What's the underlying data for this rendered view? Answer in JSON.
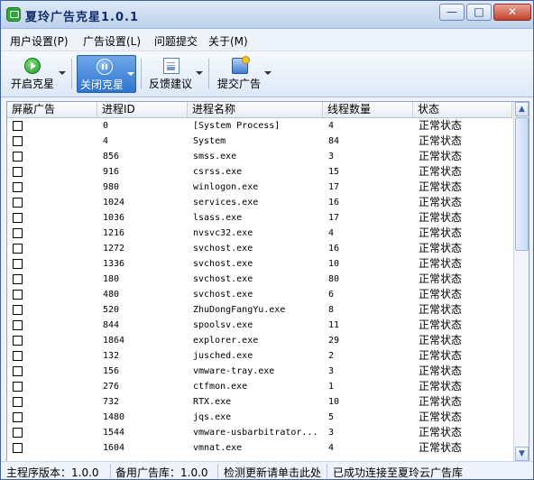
{
  "window": {
    "title": "夏玲广告克星1.0.1",
    "min_glyph": "—",
    "max_glyph": "□",
    "close_glyph": "✕"
  },
  "menu": [
    "用户设置(P)",
    "广告设置(L)",
    "问题提交",
    "关于(M)"
  ],
  "toolbar": {
    "start_label": "开启克星",
    "stop_label": "关闭克星",
    "feedback_label": "反馈建议",
    "submit_ad_label": "提交广告"
  },
  "table": {
    "columns": [
      "屏蔽广告",
      "进程ID",
      "进程名称",
      "线程数量",
      "状态"
    ],
    "rows": [
      {
        "pid": "0",
        "name": "[System Process]",
        "threads": "4",
        "status": "正常状态"
      },
      {
        "pid": "4",
        "name": "System",
        "threads": "84",
        "status": "正常状态"
      },
      {
        "pid": "856",
        "name": "smss.exe",
        "threads": "3",
        "status": "正常状态"
      },
      {
        "pid": "916",
        "name": "csrss.exe",
        "threads": "15",
        "status": "正常状态"
      },
      {
        "pid": "980",
        "name": "winlogon.exe",
        "threads": "17",
        "status": "正常状态"
      },
      {
        "pid": "1024",
        "name": "services.exe",
        "threads": "16",
        "status": "正常状态"
      },
      {
        "pid": "1036",
        "name": "lsass.exe",
        "threads": "17",
        "status": "正常状态"
      },
      {
        "pid": "1216",
        "name": "nvsvc32.exe",
        "threads": "4",
        "status": "正常状态"
      },
      {
        "pid": "1272",
        "name": "svchost.exe",
        "threads": "16",
        "status": "正常状态"
      },
      {
        "pid": "1336",
        "name": "svchost.exe",
        "threads": "10",
        "status": "正常状态"
      },
      {
        "pid": "180",
        "name": "svchost.exe",
        "threads": "80",
        "status": "正常状态"
      },
      {
        "pid": "480",
        "name": "svchost.exe",
        "threads": "6",
        "status": "正常状态"
      },
      {
        "pid": "520",
        "name": "ZhuDongFangYu.exe",
        "threads": "8",
        "status": "正常状态"
      },
      {
        "pid": "844",
        "name": "spoolsv.exe",
        "threads": "11",
        "status": "正常状态"
      },
      {
        "pid": "1864",
        "name": "explorer.exe",
        "threads": "29",
        "status": "正常状态"
      },
      {
        "pid": "132",
        "name": "jusched.exe",
        "threads": "2",
        "status": "正常状态"
      },
      {
        "pid": "156",
        "name": "vmware-tray.exe",
        "threads": "3",
        "status": "正常状态"
      },
      {
        "pid": "276",
        "name": "ctfmon.exe",
        "threads": "1",
        "status": "正常状态"
      },
      {
        "pid": "732",
        "name": "RTX.exe",
        "threads": "10",
        "status": "正常状态"
      },
      {
        "pid": "1480",
        "name": "jqs.exe",
        "threads": "5",
        "status": "正常状态"
      },
      {
        "pid": "1544",
        "name": "vmware-usbarbitrator...",
        "threads": "3",
        "status": "正常状态"
      },
      {
        "pid": "1604",
        "name": "vmnat.exe",
        "threads": "4",
        "status": "正常状态"
      }
    ]
  },
  "scrollbar": {
    "up_glyph": "▲",
    "down_glyph": "▼"
  },
  "statusbar": {
    "version": "主程序版本：1.0.0",
    "backup": "备用广告库：1.0.0",
    "update": "检测更新请单击此处",
    "connection": "已成功连接至夏玲云广告库"
  }
}
